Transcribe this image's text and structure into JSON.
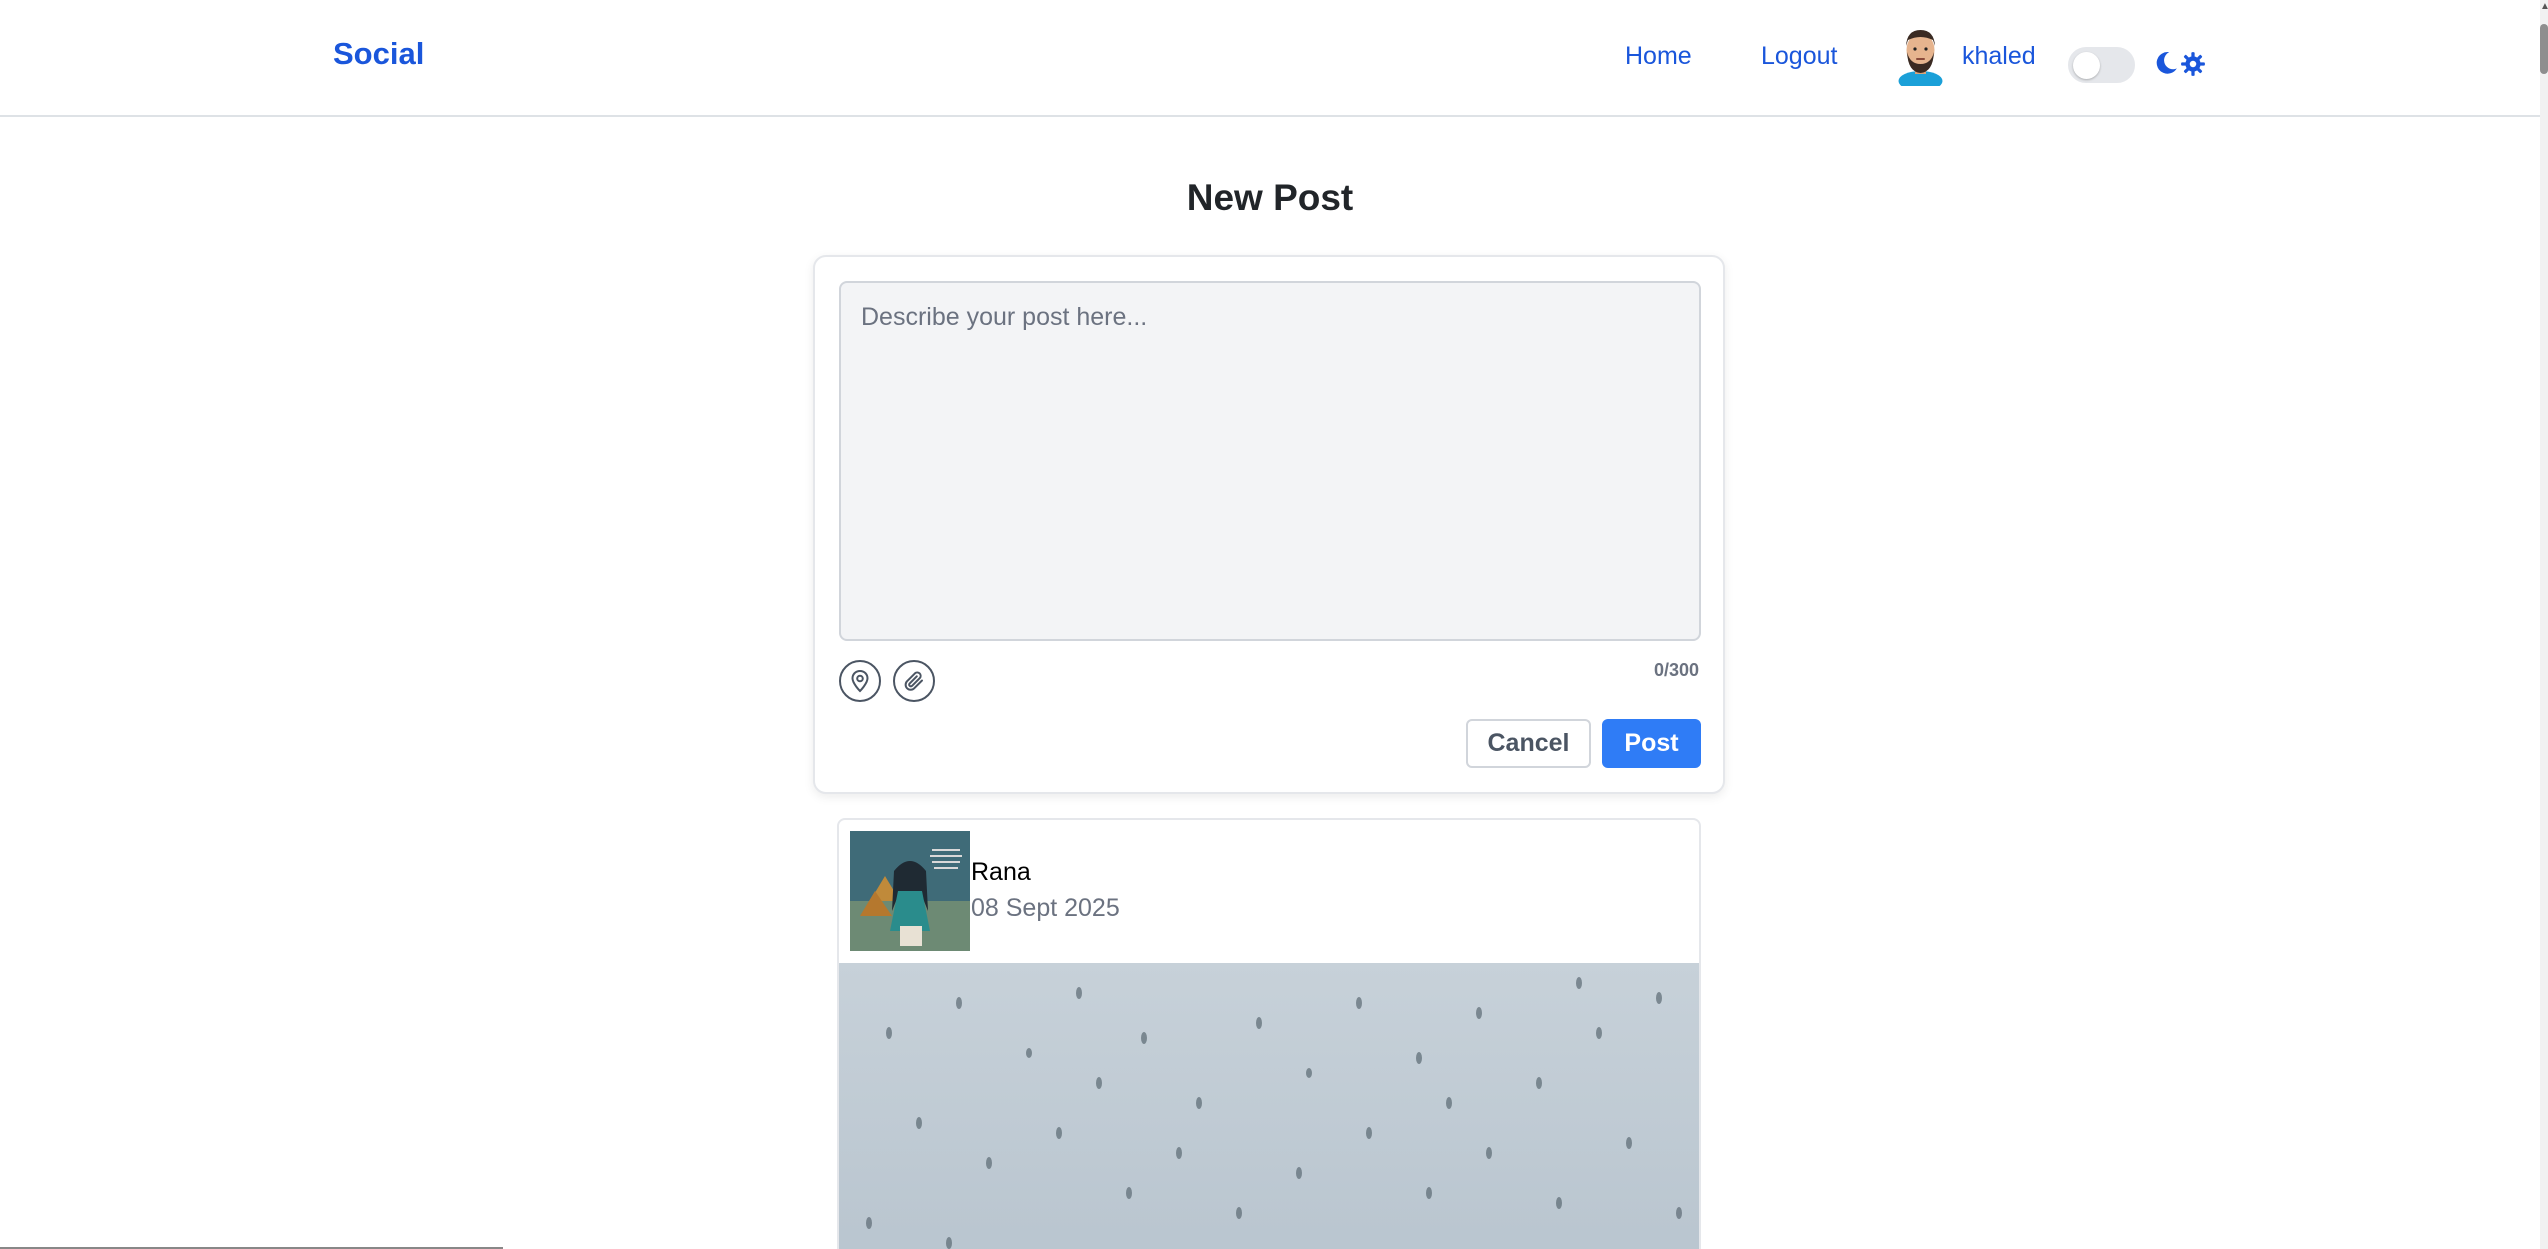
{
  "navbar": {
    "brand": "Social",
    "links": {
      "home": "Home",
      "logout": "Logout"
    },
    "user": {
      "name": "khaled"
    },
    "theme_toggle": {
      "enabled": false
    }
  },
  "page": {
    "title": "New Post"
  },
  "compose": {
    "placeholder": "Describe your post here...",
    "value": "",
    "char_count": "0/300",
    "cancel_label": "Cancel",
    "post_label": "Post"
  },
  "feed": {
    "posts": [
      {
        "author": "Rana",
        "date": "08 Sept 2025"
      }
    ]
  },
  "colors": {
    "accent": "#1a56db",
    "primary_button": "#2f7cf6",
    "textarea_bg": "#f3f4f6"
  }
}
